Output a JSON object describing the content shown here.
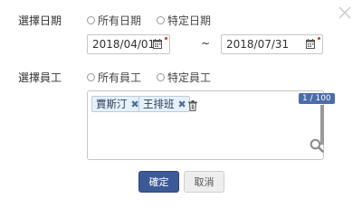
{
  "dialog": {
    "close_icon": "close-icon"
  },
  "date_section": {
    "label": "選擇日期",
    "radio_all": "所有日期",
    "radio_specific": "特定日期",
    "start_date": "2018/04/01",
    "end_date": "2018/07/31",
    "separator": "~",
    "calendar_icon": "calendar-icon"
  },
  "employee_section": {
    "label": "選擇員工",
    "radio_all": "所有員工",
    "radio_specific": "特定員工",
    "selected": [
      {
        "name": "賈斯汀"
      },
      {
        "name": "王排班"
      }
    ],
    "remove_icon": "remove-x-icon",
    "clear_icon": "trash-icon",
    "counter": "1 / 100",
    "search_icon": "search-icon"
  },
  "footer": {
    "confirm_label": "確定",
    "cancel_label": "取消"
  },
  "colors": {
    "primary": "#3d5a98",
    "tag_bg": "#e7eff8",
    "required": "#e0301e"
  }
}
